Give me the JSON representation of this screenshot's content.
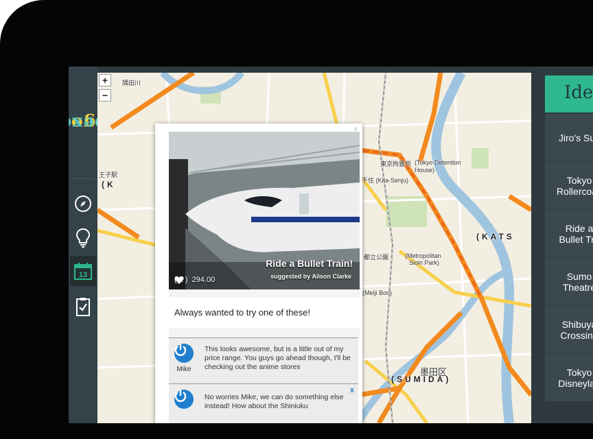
{
  "brand": {
    "logo_part1": "go",
    "logo_part2": "pexo",
    "colors": {
      "yellow": "#f2d23a",
      "teal": "#59c8c3",
      "green": "#2fb78f",
      "blue": "#1f7fcd"
    }
  },
  "nav": {
    "items": [
      {
        "name": "compass-icon"
      },
      {
        "name": "lightbulb-icon"
      },
      {
        "name": "calendar-icon",
        "label": "13",
        "active": true
      },
      {
        "name": "clipboard-check-icon"
      }
    ]
  },
  "map": {
    "zoom_in": "+",
    "zoom_out": "−",
    "labels": {
      "sumidagawa": "隅田川",
      "oji": "王子駅",
      "k_district": "(K",
      "tokyo_detention_jp": "東京拘置所",
      "tokyo_detention_en": "(Tokyo Detention",
      "house": "House)",
      "kita_senju": "北千住 (Kita-Senju)",
      "kats": "(KATS",
      "metropolitan_jp": "都立公園",
      "metropolitan_en": "(Metropolitan",
      "sioin_park": "Sioin Park)",
      "meiji_bori": "(Meiji Bori)",
      "sumida_jp": "墨田区",
      "sumida": "(SUMIDA)"
    }
  },
  "popup": {
    "close": "×",
    "title": "Ride a Bullet Train!",
    "suggested_by": "suggested by Alison Clarke",
    "likes": "( 1 )",
    "price": "294.00",
    "description": "Always wanted to try one of these!",
    "comments": [
      {
        "author": "Mike",
        "text": "This looks awesome, but is a little out of my price range. You guys go ahead though, I'll be checking out the anime stores"
      },
      {
        "author": "",
        "text": "No worries Mike, we can do something else instead! How about the Shiniuku",
        "close": "x"
      }
    ]
  },
  "ideas": {
    "title": "Ide",
    "items": [
      {
        "label": "Jiro's Sus"
      },
      {
        "label": "Tokyo\nRollercoas"
      },
      {
        "label": "Ride a\nBullet Tra"
      },
      {
        "label": "Sumo\nTheatre"
      },
      {
        "label": "Shibuya\nCrossing"
      },
      {
        "label": "Tokyo\nDisneylan"
      }
    ]
  }
}
